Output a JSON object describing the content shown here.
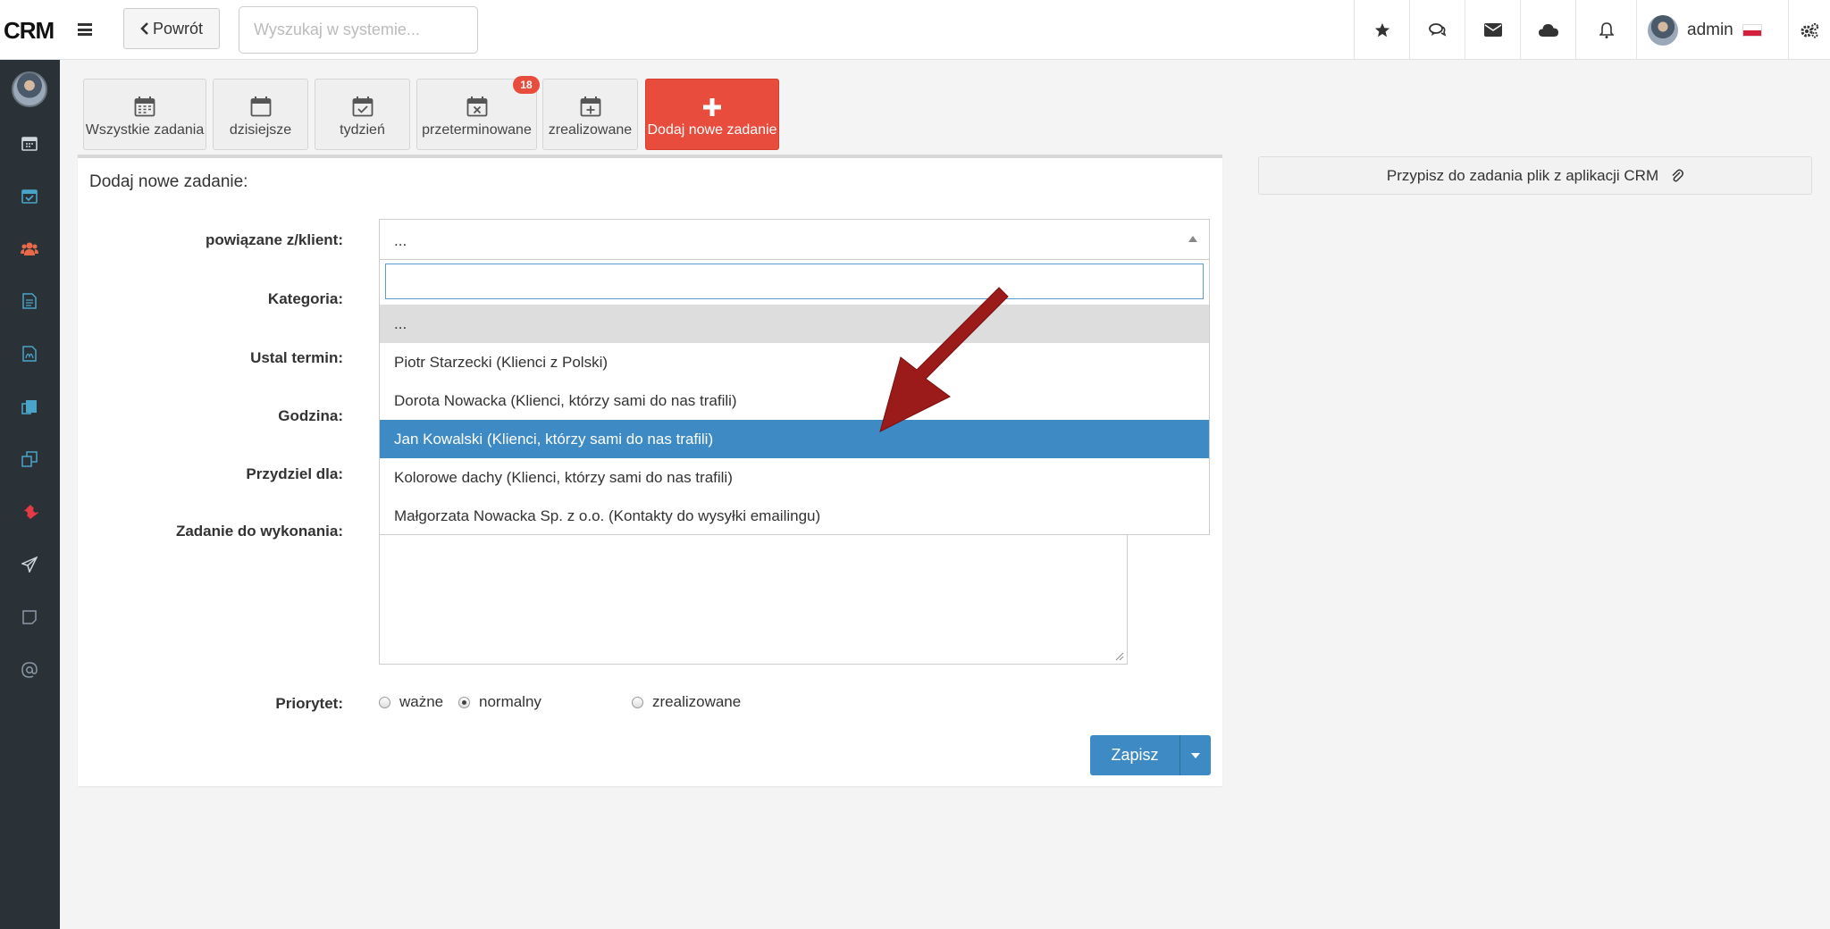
{
  "app": {
    "logo": "CRM"
  },
  "header": {
    "back_label": "Powrót",
    "search_placeholder": "Wyszukaj w systemie...",
    "icons": [
      "star-icon",
      "comments-icon",
      "envelope-icon",
      "cloud-icon",
      "bell-icon",
      "gears-icon"
    ],
    "user": {
      "name": "admin"
    }
  },
  "sidebar": {
    "icons": [
      "calendar-icon",
      "tasks-icon",
      "users-icon",
      "document-icon",
      "pdf-icon",
      "clipboard-icon",
      "copy-icon",
      "ticket-icon",
      "send-icon",
      "note-icon",
      "at-icon"
    ],
    "accent": "#4aa3c8"
  },
  "toolbar": {
    "buttons": [
      {
        "label": "Wszystkie zadania"
      },
      {
        "label": "dzisiejsze"
      },
      {
        "label": "tydzień"
      },
      {
        "label": "przeterminowane",
        "badge": "18"
      },
      {
        "label": "zrealizowane"
      },
      {
        "label": "Dodaj nowe zadanie"
      }
    ]
  },
  "form": {
    "title": "Dodaj nowe zadanie:",
    "labels": {
      "related": "powiązane z/klient:",
      "category": "Kategoria:",
      "deadline": "Ustal termin:",
      "hour": "Godzina:",
      "assign": "Przydziel dla:",
      "task": "Zadanie do wykonania:",
      "priority": "Priorytet:"
    },
    "related_value": "...",
    "dropdown": {
      "search_value": "",
      "options": [
        "...",
        "Piotr Starzecki (Klienci z Polski)",
        "Dorota Nowacka (Klienci, którzy sami do nas trafili)",
        "Jan Kowalski (Klienci, którzy sami do nas trafili)",
        "Kolorowe dachy (Klienci, którzy sami do nas trafili)",
        "Małgorzata Nowacka Sp. z o.o. (Kontakty do wysyłki emailingu)"
      ],
      "highlighted_index": 3
    },
    "priority_options": [
      "ważne",
      "normalny",
      "zrealizowane"
    ],
    "priority_selected": "normalny",
    "save_label": "Zapisz"
  },
  "attach": {
    "label": "Przypisz do zadania plik z aplikacji CRM"
  },
  "colors": {
    "primary": "#3e8ac4",
    "danger": "#e74c3c",
    "sidebar": "#2a3238",
    "arrow": "#9b1b1b"
  }
}
